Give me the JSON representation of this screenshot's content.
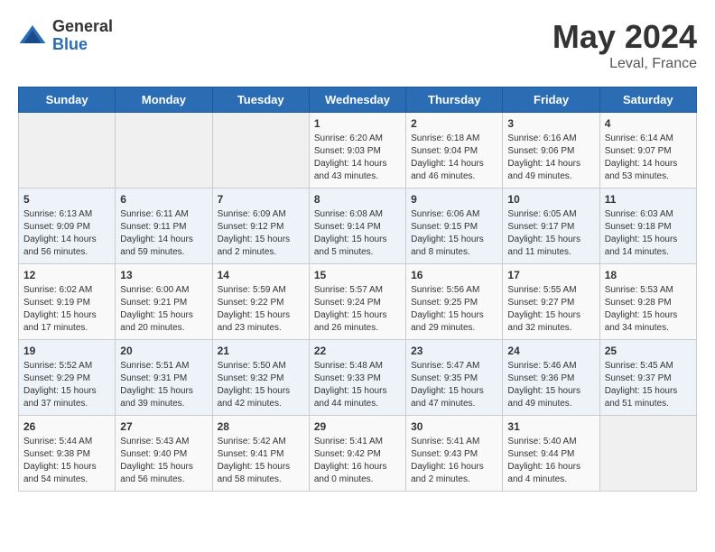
{
  "logo": {
    "general": "General",
    "blue": "Blue"
  },
  "title": {
    "month_year": "May 2024",
    "location": "Leval, France"
  },
  "weekdays": [
    "Sunday",
    "Monday",
    "Tuesday",
    "Wednesday",
    "Thursday",
    "Friday",
    "Saturday"
  ],
  "weeks": [
    [
      {
        "day": "",
        "sunrise": "",
        "sunset": "",
        "daylight": ""
      },
      {
        "day": "",
        "sunrise": "",
        "sunset": "",
        "daylight": ""
      },
      {
        "day": "",
        "sunrise": "",
        "sunset": "",
        "daylight": ""
      },
      {
        "day": "1",
        "sunrise": "Sunrise: 6:20 AM",
        "sunset": "Sunset: 9:03 PM",
        "daylight": "Daylight: 14 hours and 43 minutes."
      },
      {
        "day": "2",
        "sunrise": "Sunrise: 6:18 AM",
        "sunset": "Sunset: 9:04 PM",
        "daylight": "Daylight: 14 hours and 46 minutes."
      },
      {
        "day": "3",
        "sunrise": "Sunrise: 6:16 AM",
        "sunset": "Sunset: 9:06 PM",
        "daylight": "Daylight: 14 hours and 49 minutes."
      },
      {
        "day": "4",
        "sunrise": "Sunrise: 6:14 AM",
        "sunset": "Sunset: 9:07 PM",
        "daylight": "Daylight: 14 hours and 53 minutes."
      }
    ],
    [
      {
        "day": "5",
        "sunrise": "Sunrise: 6:13 AM",
        "sunset": "Sunset: 9:09 PM",
        "daylight": "Daylight: 14 hours and 56 minutes."
      },
      {
        "day": "6",
        "sunrise": "Sunrise: 6:11 AM",
        "sunset": "Sunset: 9:11 PM",
        "daylight": "Daylight: 14 hours and 59 minutes."
      },
      {
        "day": "7",
        "sunrise": "Sunrise: 6:09 AM",
        "sunset": "Sunset: 9:12 PM",
        "daylight": "Daylight: 15 hours and 2 minutes."
      },
      {
        "day": "8",
        "sunrise": "Sunrise: 6:08 AM",
        "sunset": "Sunset: 9:14 PM",
        "daylight": "Daylight: 15 hours and 5 minutes."
      },
      {
        "day": "9",
        "sunrise": "Sunrise: 6:06 AM",
        "sunset": "Sunset: 9:15 PM",
        "daylight": "Daylight: 15 hours and 8 minutes."
      },
      {
        "day": "10",
        "sunrise": "Sunrise: 6:05 AM",
        "sunset": "Sunset: 9:17 PM",
        "daylight": "Daylight: 15 hours and 11 minutes."
      },
      {
        "day": "11",
        "sunrise": "Sunrise: 6:03 AM",
        "sunset": "Sunset: 9:18 PM",
        "daylight": "Daylight: 15 hours and 14 minutes."
      }
    ],
    [
      {
        "day": "12",
        "sunrise": "Sunrise: 6:02 AM",
        "sunset": "Sunset: 9:19 PM",
        "daylight": "Daylight: 15 hours and 17 minutes."
      },
      {
        "day": "13",
        "sunrise": "Sunrise: 6:00 AM",
        "sunset": "Sunset: 9:21 PM",
        "daylight": "Daylight: 15 hours and 20 minutes."
      },
      {
        "day": "14",
        "sunrise": "Sunrise: 5:59 AM",
        "sunset": "Sunset: 9:22 PM",
        "daylight": "Daylight: 15 hours and 23 minutes."
      },
      {
        "day": "15",
        "sunrise": "Sunrise: 5:57 AM",
        "sunset": "Sunset: 9:24 PM",
        "daylight": "Daylight: 15 hours and 26 minutes."
      },
      {
        "day": "16",
        "sunrise": "Sunrise: 5:56 AM",
        "sunset": "Sunset: 9:25 PM",
        "daylight": "Daylight: 15 hours and 29 minutes."
      },
      {
        "day": "17",
        "sunrise": "Sunrise: 5:55 AM",
        "sunset": "Sunset: 9:27 PM",
        "daylight": "Daylight: 15 hours and 32 minutes."
      },
      {
        "day": "18",
        "sunrise": "Sunrise: 5:53 AM",
        "sunset": "Sunset: 9:28 PM",
        "daylight": "Daylight: 15 hours and 34 minutes."
      }
    ],
    [
      {
        "day": "19",
        "sunrise": "Sunrise: 5:52 AM",
        "sunset": "Sunset: 9:29 PM",
        "daylight": "Daylight: 15 hours and 37 minutes."
      },
      {
        "day": "20",
        "sunrise": "Sunrise: 5:51 AM",
        "sunset": "Sunset: 9:31 PM",
        "daylight": "Daylight: 15 hours and 39 minutes."
      },
      {
        "day": "21",
        "sunrise": "Sunrise: 5:50 AM",
        "sunset": "Sunset: 9:32 PM",
        "daylight": "Daylight: 15 hours and 42 minutes."
      },
      {
        "day": "22",
        "sunrise": "Sunrise: 5:48 AM",
        "sunset": "Sunset: 9:33 PM",
        "daylight": "Daylight: 15 hours and 44 minutes."
      },
      {
        "day": "23",
        "sunrise": "Sunrise: 5:47 AM",
        "sunset": "Sunset: 9:35 PM",
        "daylight": "Daylight: 15 hours and 47 minutes."
      },
      {
        "day": "24",
        "sunrise": "Sunrise: 5:46 AM",
        "sunset": "Sunset: 9:36 PM",
        "daylight": "Daylight: 15 hours and 49 minutes."
      },
      {
        "day": "25",
        "sunrise": "Sunrise: 5:45 AM",
        "sunset": "Sunset: 9:37 PM",
        "daylight": "Daylight: 15 hours and 51 minutes."
      }
    ],
    [
      {
        "day": "26",
        "sunrise": "Sunrise: 5:44 AM",
        "sunset": "Sunset: 9:38 PM",
        "daylight": "Daylight: 15 hours and 54 minutes."
      },
      {
        "day": "27",
        "sunrise": "Sunrise: 5:43 AM",
        "sunset": "Sunset: 9:40 PM",
        "daylight": "Daylight: 15 hours and 56 minutes."
      },
      {
        "day": "28",
        "sunrise": "Sunrise: 5:42 AM",
        "sunset": "Sunset: 9:41 PM",
        "daylight": "Daylight: 15 hours and 58 minutes."
      },
      {
        "day": "29",
        "sunrise": "Sunrise: 5:41 AM",
        "sunset": "Sunset: 9:42 PM",
        "daylight": "Daylight: 16 hours and 0 minutes."
      },
      {
        "day": "30",
        "sunrise": "Sunrise: 5:41 AM",
        "sunset": "Sunset: 9:43 PM",
        "daylight": "Daylight: 16 hours and 2 minutes."
      },
      {
        "day": "31",
        "sunrise": "Sunrise: 5:40 AM",
        "sunset": "Sunset: 9:44 PM",
        "daylight": "Daylight: 16 hours and 4 minutes."
      },
      {
        "day": "",
        "sunrise": "",
        "sunset": "",
        "daylight": ""
      }
    ]
  ]
}
